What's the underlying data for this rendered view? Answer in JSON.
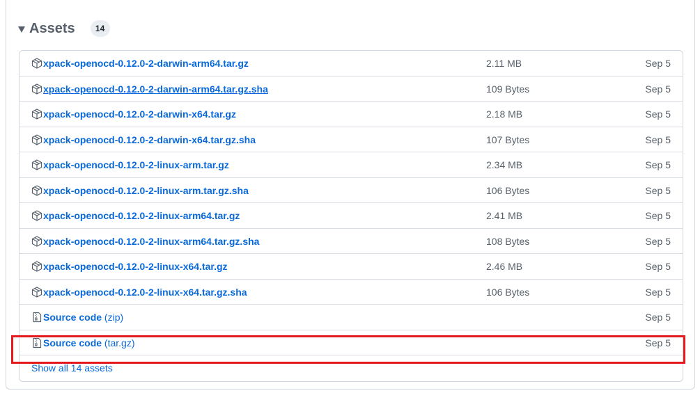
{
  "assets": {
    "title": "Assets",
    "count": "14",
    "items": [
      {
        "name": "xpack-openocd-0.12.0-2-darwin-arm64.tar.gz",
        "suffix": "",
        "size": "2.11 MB",
        "date": "Sep 5",
        "icon": "package-icon"
      },
      {
        "name": "xpack-openocd-0.12.0-2-darwin-arm64.tar.gz.sha",
        "suffix": "",
        "size": "109 Bytes",
        "date": "Sep 5",
        "icon": "package-icon"
      },
      {
        "name": "xpack-openocd-0.12.0-2-darwin-x64.tar.gz",
        "suffix": "",
        "size": "2.18 MB",
        "date": "Sep 5",
        "icon": "package-icon"
      },
      {
        "name": "xpack-openocd-0.12.0-2-darwin-x64.tar.gz.sha",
        "suffix": "",
        "size": "107 Bytes",
        "date": "Sep 5",
        "icon": "package-icon"
      },
      {
        "name": "xpack-openocd-0.12.0-2-linux-arm.tar.gz",
        "suffix": "",
        "size": "2.34 MB",
        "date": "Sep 5",
        "icon": "package-icon"
      },
      {
        "name": "xpack-openocd-0.12.0-2-linux-arm.tar.gz.sha",
        "suffix": "",
        "size": "106 Bytes",
        "date": "Sep 5",
        "icon": "package-icon"
      },
      {
        "name": "xpack-openocd-0.12.0-2-linux-arm64.tar.gz",
        "suffix": "",
        "size": "2.41 MB",
        "date": "Sep 5",
        "icon": "package-icon"
      },
      {
        "name": "xpack-openocd-0.12.0-2-linux-arm64.tar.gz.sha",
        "suffix": "",
        "size": "108 Bytes",
        "date": "Sep 5",
        "icon": "package-icon"
      },
      {
        "name": "xpack-openocd-0.12.0-2-linux-x64.tar.gz",
        "suffix": "",
        "size": "2.46 MB",
        "date": "Sep 5",
        "icon": "package-icon"
      },
      {
        "name": "xpack-openocd-0.12.0-2-linux-x64.tar.gz.sha",
        "suffix": "",
        "size": "106 Bytes",
        "date": "Sep 5",
        "icon": "package-icon"
      },
      {
        "name": "Source code",
        "suffix": " (zip)",
        "size": "",
        "date": "Sep 5",
        "icon": "file-zip-icon"
      },
      {
        "name": "Source code",
        "suffix": " (tar.gz)",
        "size": "",
        "date": "Sep 5",
        "icon": "file-zip-icon"
      }
    ],
    "show_all": "Show all 14 assets"
  },
  "colors": {
    "link": "#0969da",
    "muted": "#57606a",
    "border": "#d0d7de",
    "highlight": "#e5191c"
  }
}
